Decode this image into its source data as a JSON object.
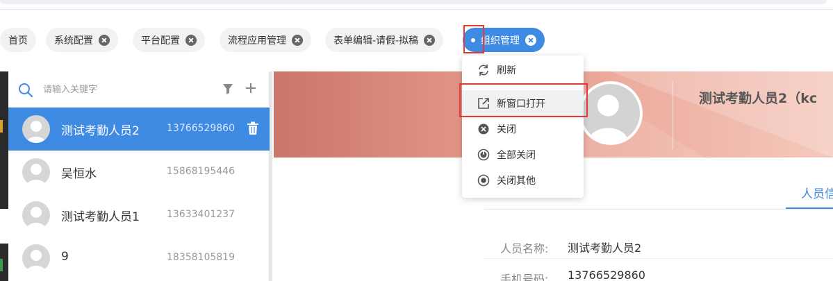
{
  "colors": {
    "accent": "#3f8ae2",
    "highlight_box": "#e53935"
  },
  "tabs": [
    {
      "label": "首页",
      "closable": false
    },
    {
      "label": "系统配置",
      "closable": true
    },
    {
      "label": "平台配置",
      "closable": true
    },
    {
      "label": "流程应用管理",
      "closable": true
    },
    {
      "label": "表单编辑-请假-拟稿",
      "closable": true
    },
    {
      "label": "组织管理",
      "closable": true,
      "active": true
    }
  ],
  "context_menu": {
    "items": [
      {
        "label": "刷新",
        "icon": "refresh-icon"
      },
      {
        "label": "新窗口打开",
        "icon": "external-link-icon"
      },
      {
        "label": "关闭",
        "icon": "close-circle-icon"
      },
      {
        "label": "全部关闭",
        "icon": "power-icon"
      },
      {
        "label": "关闭其他",
        "icon": "radio-dot-icon"
      }
    ]
  },
  "search": {
    "placeholder": "请输入关键字",
    "value": ""
  },
  "people": [
    {
      "name": "测试考勤人员2",
      "phone": "13766529860",
      "selected": true
    },
    {
      "name": "吴恒水",
      "phone": "15868195446"
    },
    {
      "name": "测试考勤人员1",
      "phone": "13633401237"
    },
    {
      "name": "9",
      "phone": "18358105819"
    }
  ],
  "profile": {
    "title": "测试考勤人员2（kc",
    "tab_label": "人员信",
    "fields": [
      {
        "label": "人员名称:",
        "value": "测试考勤人员2"
      },
      {
        "label": "手机号码:",
        "value": "13766529860"
      }
    ]
  }
}
